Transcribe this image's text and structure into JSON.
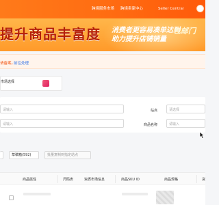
{
  "topbar": {
    "nav": [
      "跨境服务市场",
      "跨境卖家中心",
      "Seller Central"
    ]
  },
  "banner": {
    "headline": "提升商品丰富度",
    "promo_line1": "消费者更容易凑单达到",
    "promo_line2": "助力提升店铺销量",
    "badge": "包邮门"
  },
  "notice": {
    "text": "请备案。",
    "link": "前往处理"
  },
  "selector": {
    "label": "市场选择"
  },
  "filters": {
    "input1_placeholder": "请输入",
    "input2_placeholder": "请输入",
    "label_site": "站点",
    "select_site_placeholder": "请选择",
    "label_product_name": "商品名称",
    "input_product_name_placeholder": "请输入"
  },
  "tabs": [
    {
      "label": ""
    },
    {
      "label": "草稿箱(592)"
    },
    {
      "label": "批量复制到指定站点"
    }
  ],
  "table": {
    "headers": [
      "",
      "商品属性",
      "尺码表",
      "资质市场信息",
      "商品SKU ID",
      "商品规格",
      "货"
    ]
  },
  "colors": {
    "brand_orange": "#ff6d12",
    "link_blue": "#3b78e7",
    "notice_text": "#f25a1a"
  }
}
